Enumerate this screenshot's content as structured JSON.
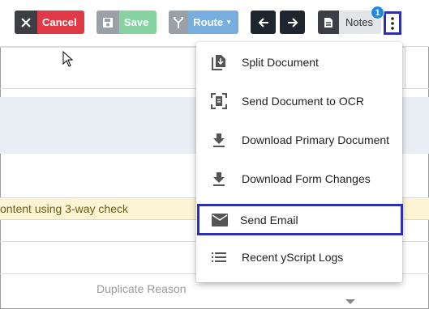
{
  "toolbar": {
    "cancel_label": "Cancel",
    "save_label": "Save",
    "route_label": "Route",
    "notes_label": "Notes",
    "notes_badge": "1"
  },
  "content": {
    "warning_text": "ontent using 3-way check",
    "duplicate_reason_placeholder": "Duplicate Reason"
  },
  "menu": {
    "items": [
      {
        "label": "Split Document",
        "icon": "split-document-icon"
      },
      {
        "label": "Send Document to OCR",
        "icon": "ocr-scan-icon"
      },
      {
        "label": "Download Primary Document",
        "icon": "download-icon"
      },
      {
        "label": "Download Form Changes",
        "icon": "download-icon"
      },
      {
        "label": "Send Email",
        "icon": "email-icon",
        "highlighted": true
      },
      {
        "label": "Recent yScript Logs",
        "icon": "list-icon"
      }
    ]
  },
  "colors": {
    "cancel": "#e03a47",
    "save": "#86d2a1",
    "route": "#77aedd",
    "highlight_border": "#2b2fb0",
    "badge": "#1e88e5"
  }
}
